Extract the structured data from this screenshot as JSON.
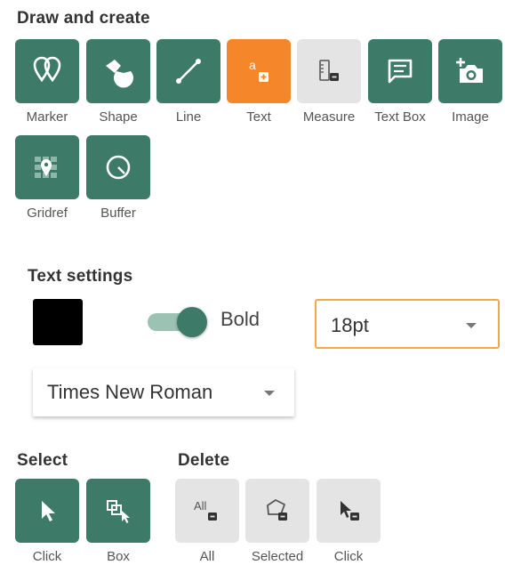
{
  "draw": {
    "title": "Draw and create",
    "tools": [
      {
        "label": "Marker",
        "icon": "marker-icon"
      },
      {
        "label": "Shape",
        "icon": "shape-icon"
      },
      {
        "label": "Line",
        "icon": "line-icon"
      },
      {
        "label": "Text",
        "icon": "text-icon",
        "glyph": "a",
        "state": "active"
      },
      {
        "label": "Measure",
        "icon": "measure-icon",
        "state": "disabled"
      },
      {
        "label": "Text Box",
        "icon": "text-box-icon"
      },
      {
        "label": "Image",
        "icon": "add-image-icon"
      },
      {
        "label": "Gridref",
        "icon": "gridref-icon"
      },
      {
        "label": "Buffer",
        "icon": "buffer-icon"
      }
    ]
  },
  "text_settings": {
    "title": "Text settings",
    "color": "#000000",
    "bold_label": "Bold",
    "bold_on": true,
    "size_value": "18pt",
    "font_value": "Times New Roman"
  },
  "select": {
    "title": "Select",
    "tools": [
      {
        "label": "Click",
        "icon": "cursor-icon"
      },
      {
        "label": "Box",
        "icon": "box-select-icon"
      }
    ]
  },
  "delete": {
    "title": "Delete",
    "tools": [
      {
        "label": "All",
        "icon": "delete-all-icon",
        "glyph": "All"
      },
      {
        "label": "Selected",
        "icon": "delete-selected-icon"
      },
      {
        "label": "Click",
        "icon": "delete-click-icon"
      }
    ]
  },
  "colors": {
    "primary": "#3d7a68",
    "active": "#f5862a",
    "disabled": "#e4e4e4",
    "focus_border": "#f0a84a"
  }
}
